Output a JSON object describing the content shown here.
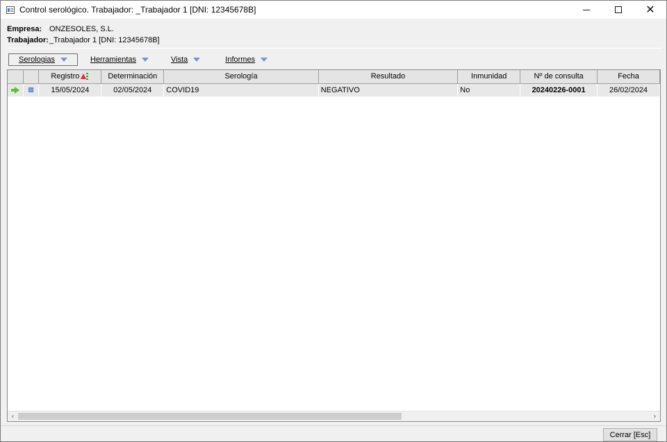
{
  "window": {
    "title": "Control serológico. Trabajador: _Trabajador 1 [DNI: 12345678B]",
    "icon": "app-window-icon",
    "controls": {
      "minimize": "minimize-icon",
      "maximize": "maximize-icon",
      "close": "close-icon"
    }
  },
  "header": {
    "empresa_label": "Empresa:",
    "empresa_value": "ONZESOLES, S.L.",
    "trabajador_label": "Trabajador:",
    "trabajador_value": "_Trabajador 1 [DNI: 12345678B]"
  },
  "menu": {
    "items": [
      {
        "label": "Serologias",
        "active": true
      },
      {
        "label": "Herramientas",
        "active": false
      },
      {
        "label": "Vista",
        "active": false
      },
      {
        "label": "Informes",
        "active": false
      }
    ]
  },
  "grid": {
    "columns": [
      "",
      "",
      "Registro",
      "Determinación",
      "Serología",
      "Resultado",
      "Inmunidad",
      "Nº de consulta",
      "Fecha"
    ],
    "rows": [
      {
        "registro": "15/05/2024",
        "determinacion": "02/05/2024",
        "serologia": "COVID19",
        "resultado": "NEGATIVO",
        "inmunidad": "No",
        "consulta": "20240226-0001",
        "fecha": "26/02/2024"
      }
    ],
    "sort_icon": "sort-ascending-icon",
    "row_pointer_icon": "current-row-arrow-icon"
  },
  "footer": {
    "close_label": "Cerrar  [Esc]"
  },
  "colors": {
    "row_background": "#e8e8e8",
    "header_background": "#e4e4e4",
    "menu_arrow": "#7396d1",
    "pointer_arrow": "#5cc12b"
  }
}
